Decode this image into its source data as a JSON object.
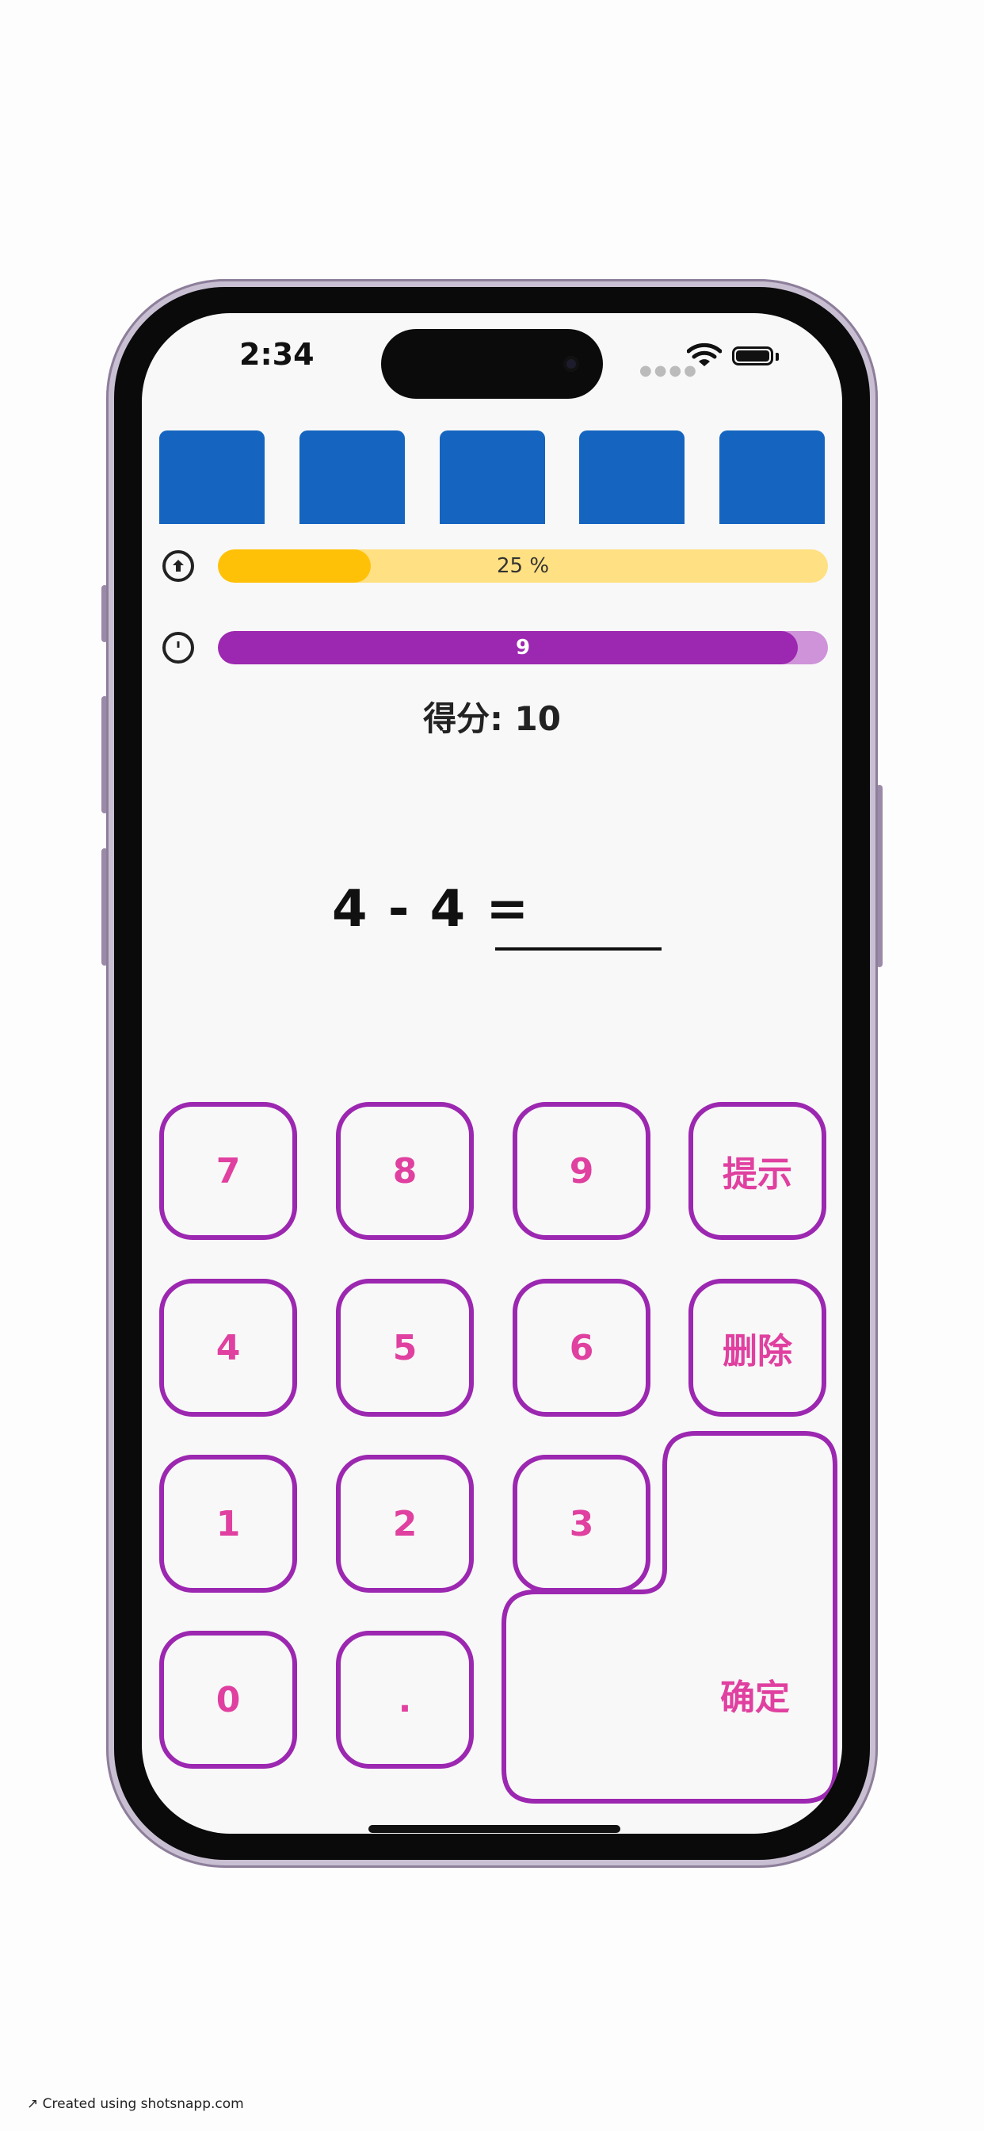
{
  "status_bar": {
    "time": "2:34"
  },
  "progress": {
    "label": "25 %",
    "fraction": 0.25
  },
  "timer": {
    "label": "9",
    "fraction": 0.95
  },
  "score": {
    "label": "得分: ",
    "value": "10"
  },
  "question": {
    "text": "4 - 4 ="
  },
  "keypad": {
    "k7": "7",
    "k8": "8",
    "k9": "9",
    "hint": "提示",
    "k4": "4",
    "k5": "5",
    "k6": "6",
    "delete": "删除",
    "k1": "1",
    "k2": "2",
    "k3": "3",
    "k0": "0",
    "dot": ".",
    "confirm": "确定"
  },
  "footer": {
    "credit": "Created using shotsnapp.com"
  },
  "colors": {
    "tile": "#1565c0",
    "progress_track": "#ffe082",
    "progress_fill": "#ffc107",
    "timer_track": "#ce93d8",
    "timer_fill": "#9c27b0",
    "key_border": "#9c27b0",
    "key_text": "#e040a0"
  },
  "icons": {
    "progress": "upload-circle-icon",
    "timer": "stopwatch-icon"
  }
}
